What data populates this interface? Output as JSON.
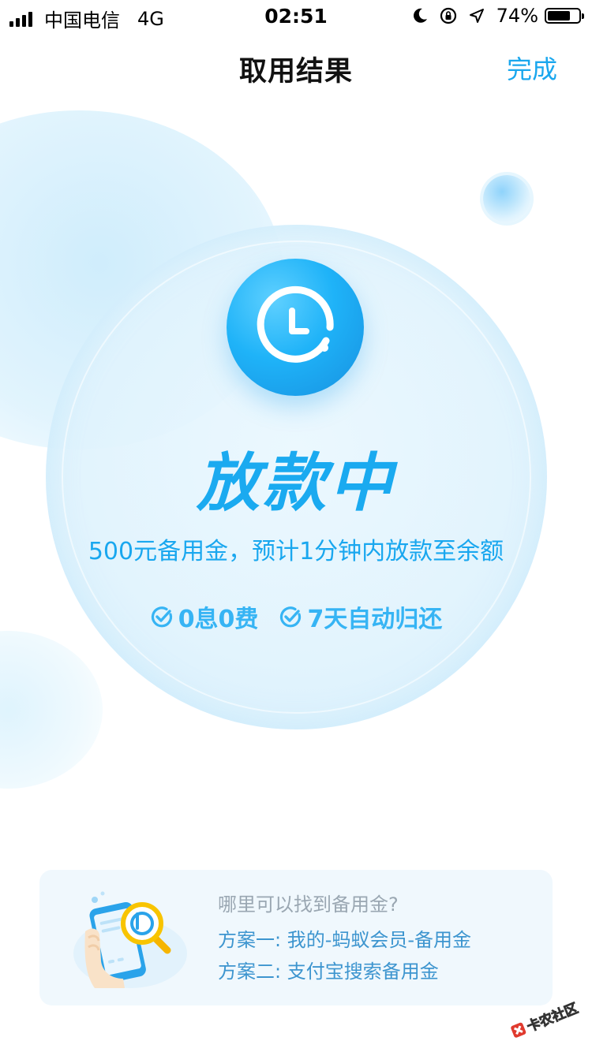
{
  "status_bar": {
    "carrier": "中国电信",
    "network": "4G",
    "time": "02:51",
    "battery_percent_label": "74%",
    "battery_level": 0.74
  },
  "nav": {
    "title": "取用结果",
    "done_label": "完成"
  },
  "result": {
    "heading": "放款中",
    "description": "500元备用金，预计1分钟内放款至余额",
    "features": [
      {
        "label": "0息0费",
        "icon": "check-circle-icon"
      },
      {
        "label": "7天自动归还",
        "icon": "check-circle-icon"
      }
    ]
  },
  "tip": {
    "title": "哪里可以找到备用金?",
    "options": [
      "方案一: 我的-蚂蚁会员-备用金",
      "方案二: 支付宝搜索备用金"
    ]
  },
  "watermark": {
    "text": "卡农社区"
  },
  "colors": {
    "accent": "#1aaaf0",
    "link": "#1aa7ee",
    "tip_text": "#3d95cf",
    "tip_bg": "#f0f8fd"
  }
}
